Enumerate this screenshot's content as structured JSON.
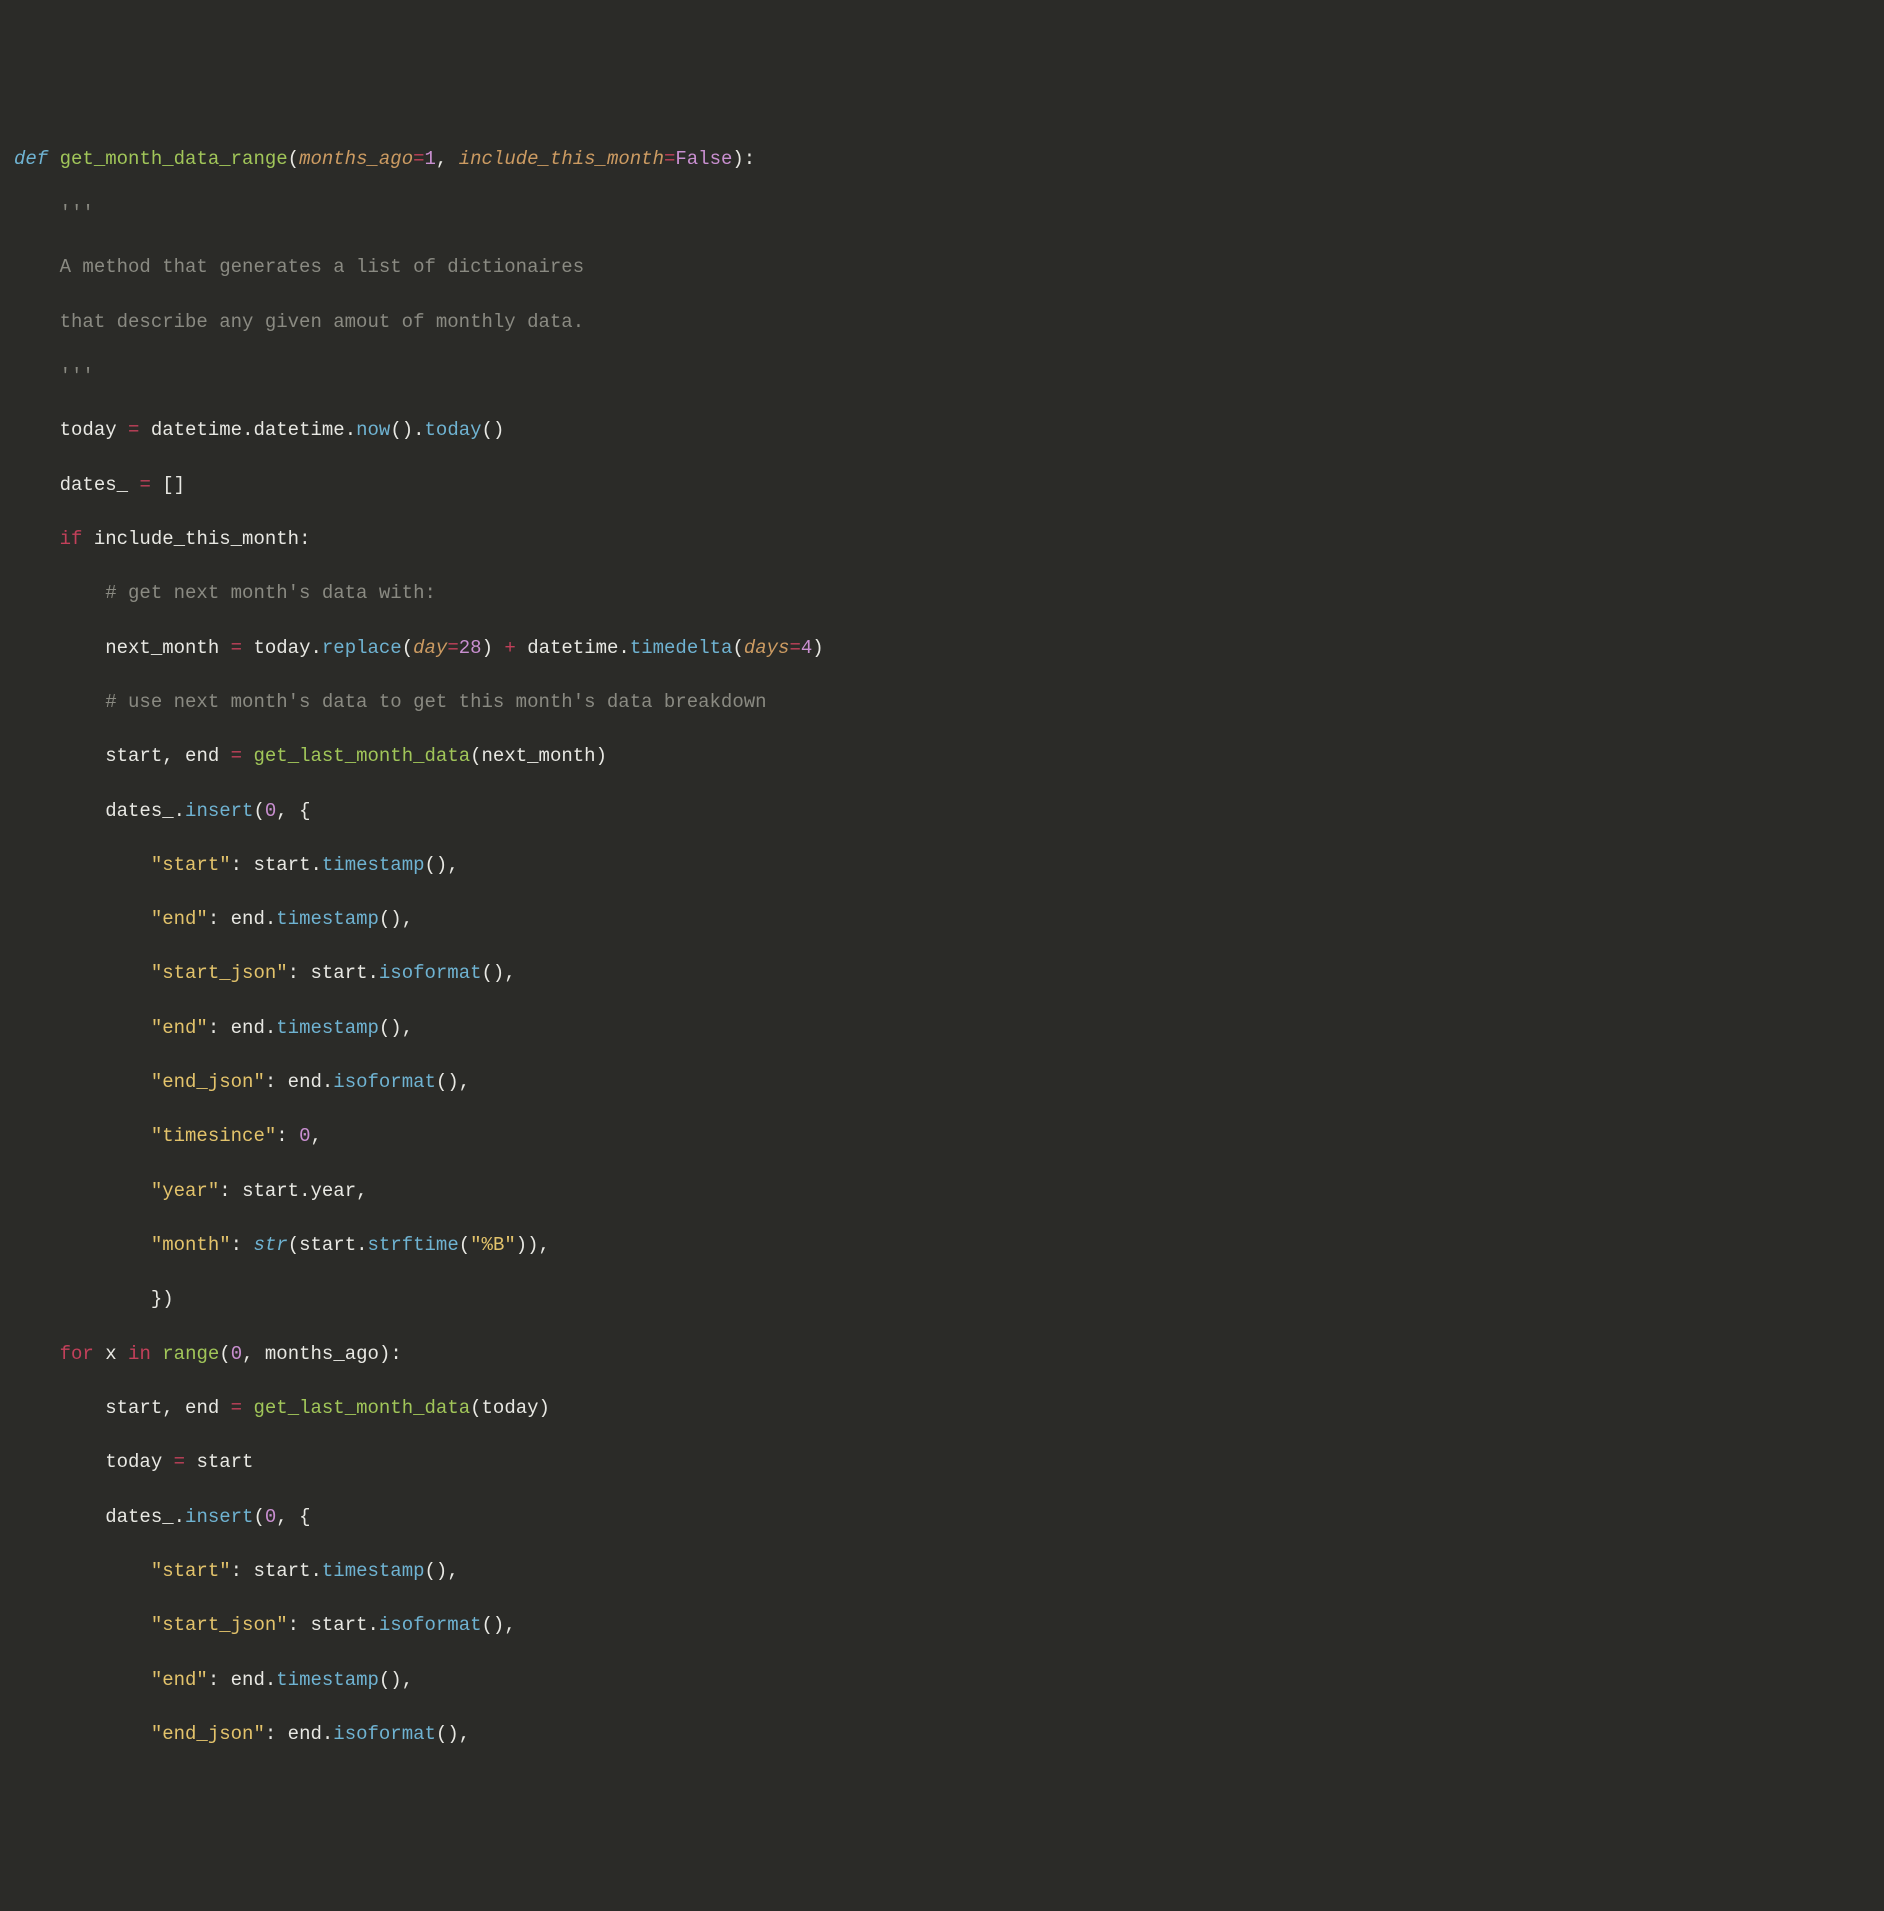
{
  "code": {
    "line1_def": "def",
    "line1_fn": "get_month_data_range",
    "line1_p1": "months_ago",
    "line1_v1": "1",
    "line1_p2": "include_this_month",
    "line1_v2": "False",
    "line2_tq": "'''",
    "line3_doc": "A method that generates a list of dictionaires",
    "line4_doc": "that describe any given amout of monthly data.",
    "line5_tq": "'''",
    "line6_today": "today",
    "line6_dt1": "datetime",
    "line6_dt2": "datetime",
    "line6_now": "now",
    "line6_today2": "today",
    "line7_dates": "dates_",
    "line8_if": "if",
    "line8_cond": "include_this_month",
    "line9_cmt": "# get next month's data with:",
    "line10_nm": "next_month",
    "line10_today": "today",
    "line10_replace": "replace",
    "line10_day": "day",
    "line10_28": "28",
    "line10_dt": "datetime",
    "line10_td": "timedelta",
    "line10_days": "days",
    "line10_4": "4",
    "line11_cmt": "# use next month's data to get this month's data breakdown",
    "line12_start": "start",
    "line12_end": "end",
    "line12_glmd": "get_last_month_data",
    "line12_arg": "next_month",
    "line13_dates": "dates_",
    "line13_insert": "insert",
    "line13_0": "0",
    "line14_k": "\"start\"",
    "line14_start": "start",
    "line14_ts": "timestamp",
    "line15_k": "\"end\"",
    "line15_end": "end",
    "line15_ts": "timestamp",
    "line16_k": "\"start_json\"",
    "line16_start": "start",
    "line16_iso": "isoformat",
    "line17_k": "\"end\"",
    "line17_end": "end",
    "line17_ts": "timestamp",
    "line18_k": "\"end_json\"",
    "line18_end": "end",
    "line18_iso": "isoformat",
    "line19_k": "\"timesince\"",
    "line19_0": "0",
    "line20_k": "\"year\"",
    "line20_start": "start",
    "line20_year": "year",
    "line21_k": "\"month\"",
    "line21_str": "str",
    "line21_start": "start",
    "line21_strftime": "strftime",
    "line21_fmt": "\"%B\"",
    "line23_for": "for",
    "line23_x": "x",
    "line23_in": "in",
    "line23_range": "range",
    "line23_0": "0",
    "line23_ma": "months_ago",
    "line24_start": "start",
    "line24_end": "end",
    "line24_glmd": "get_last_month_data",
    "line24_today": "today",
    "line25_today": "today",
    "line25_start": "start",
    "line26_dates": "dates_",
    "line26_insert": "insert",
    "line26_0": "0",
    "line27_k": "\"start\"",
    "line27_start": "start",
    "line27_ts": "timestamp",
    "line28_k": "\"start_json\"",
    "line28_start": "start",
    "line28_iso": "isoformat",
    "line29_k": "\"end\"",
    "line29_end": "end",
    "line29_ts": "timestamp",
    "line30_k": "\"end_json\"",
    "line30_end": "end",
    "line30_iso": "isoformat"
  }
}
